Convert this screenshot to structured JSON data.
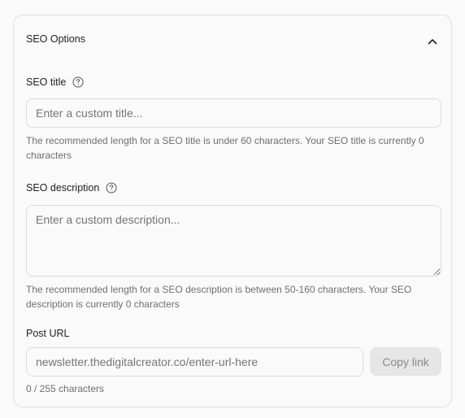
{
  "seo_options": {
    "header_title": "SEO Options",
    "expanded": true,
    "seo_title": {
      "label": "SEO title",
      "placeholder": "Enter a custom title...",
      "value": "",
      "hint": "The recommended length for a SEO title is under 60 characters. Your SEO title is currently 0 characters"
    },
    "seo_description": {
      "label": "SEO description",
      "placeholder": "Enter a custom description...",
      "value": "",
      "hint": "The recommended length for a SEO description is between 50-160 characters. Your SEO description is currently 0 characters"
    },
    "post_url": {
      "label": "Post URL",
      "placeholder": "newsletter.thedigitalcreator.co/enter-url-here",
      "value": "",
      "copy_label": "Copy link",
      "char_count": "0 / 255 characters"
    }
  },
  "icons": {
    "collapse": "chevron-up-icon",
    "help": "question-circle-icon"
  },
  "colors": {
    "background": "#fafafa",
    "border": "#e1e1e1",
    "hint_text": "#6f6f6f",
    "button_bg": "#e6e6e6"
  }
}
